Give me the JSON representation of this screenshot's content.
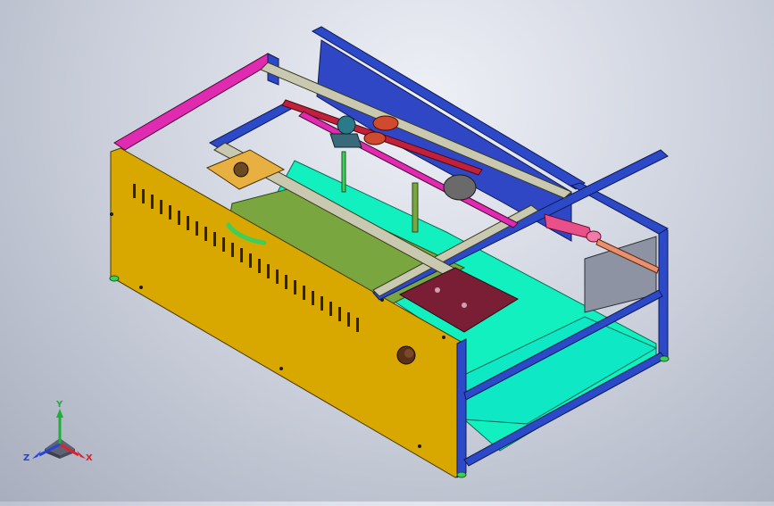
{
  "viewport": {
    "model": "cnc-laser-engraver-frame-assembly",
    "view": "isometric",
    "display_style": "shaded-with-edges",
    "background_colors": [
      "#eef0f6",
      "#a8aebd"
    ]
  },
  "triad": {
    "x_label": "X",
    "y_label": "Y",
    "z_label": "Z",
    "colors": {
      "x": "#e0202a",
      "y": "#1fae3a",
      "z": "#2545d8"
    }
  },
  "part_colors": {
    "side_panel": "#d9a800",
    "side_panel_dark": "#b08800",
    "frame_blue": "#2c49c8",
    "frame_edge": "#101a55",
    "bed_cyan": "#12f0c0",
    "gantry_green": "#7aa640",
    "rail_magenta": "#e02ab0",
    "carriage_maroon": "#7a1e36",
    "tube_pink": "#e8508a",
    "rod_salmon": "#e89070",
    "knob_brown": "#5a3018"
  }
}
